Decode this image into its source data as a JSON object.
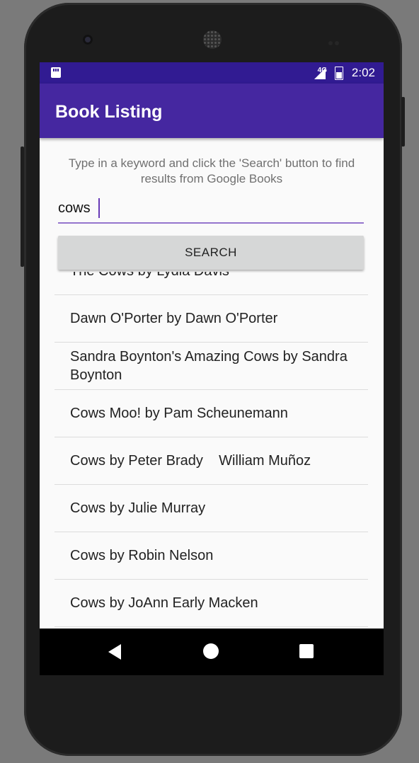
{
  "status_bar": {
    "network": "4G",
    "time": "2:02"
  },
  "app_bar": {
    "title": "Book Listing"
  },
  "hint": {
    "text": "Type in a keyword and click the 'Search' button to find results from Google Books"
  },
  "search": {
    "value": "cows",
    "button_label": "SEARCH"
  },
  "results": [
    "The Cows by Lydia Davis",
    "Dawn O'Porter by Dawn O'Porter",
    "Sandra Boynton's Amazing Cows by Sandra Boynton",
    "Cows Moo! by Pam Scheunemann",
    "Cows by Peter Brady    William Muñoz",
    "Cows by Julie Murray",
    "Cows by Robin Nelson",
    "Cows by JoAnn Early Macken"
  ],
  "colors": {
    "status_bar": "#311b92",
    "app_bar": "#4527a0",
    "accent": "#673ab7"
  }
}
